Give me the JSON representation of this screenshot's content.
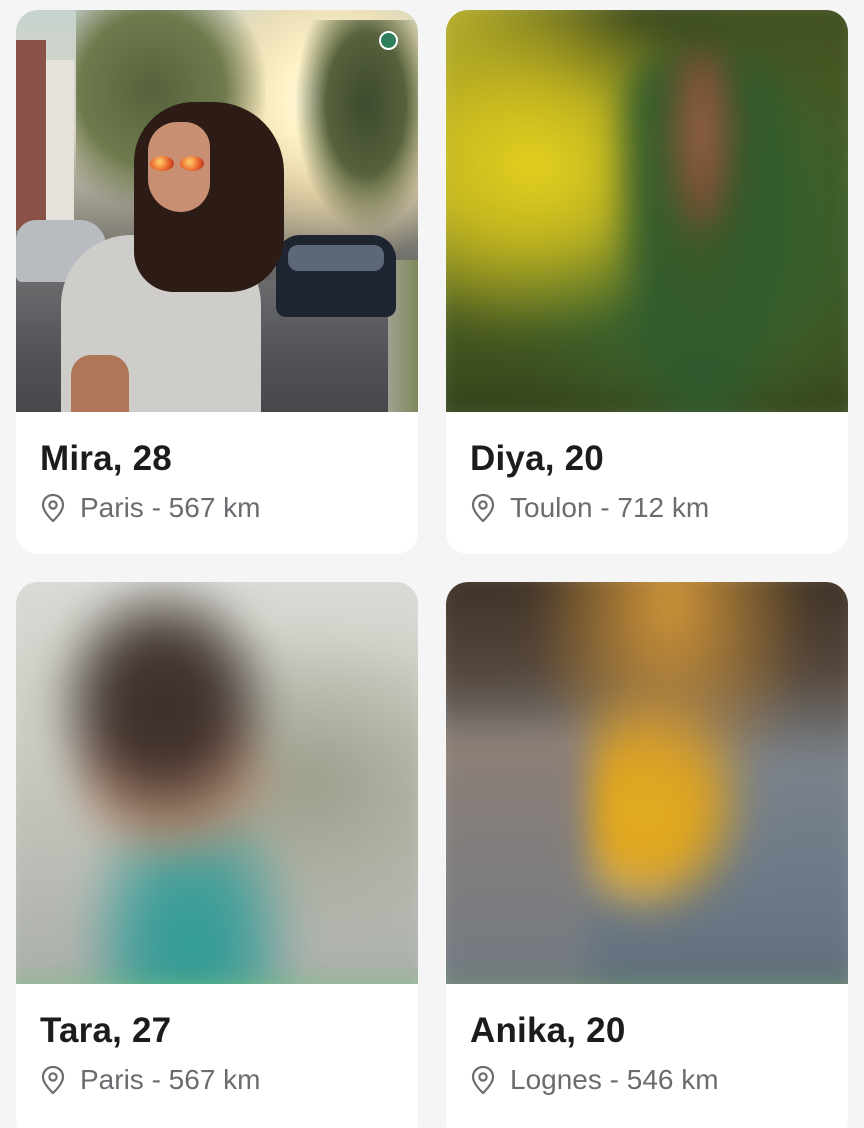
{
  "profiles": [
    {
      "name_age": "Mira, 28",
      "location": "Paris - 567 km",
      "photo_blurred": false,
      "online": true
    },
    {
      "name_age": "Diya, 20",
      "location": "Toulon - 712 km",
      "photo_blurred": true,
      "online": false
    },
    {
      "name_age": "Tara, 27",
      "location": "Paris - 567 km",
      "photo_blurred": true,
      "online": false
    },
    {
      "name_age": "Anika, 20",
      "location": "Lognes - 546 km",
      "photo_blurred": true,
      "online": false
    }
  ],
  "colors": {
    "online_indicator": "#2e7d5b",
    "name_text": "#1d1b1e",
    "location_text": "#6d6b70",
    "background": "#f6f5f6"
  },
  "icons": {
    "location": "location-pin-icon",
    "online": "online-status-icon"
  }
}
